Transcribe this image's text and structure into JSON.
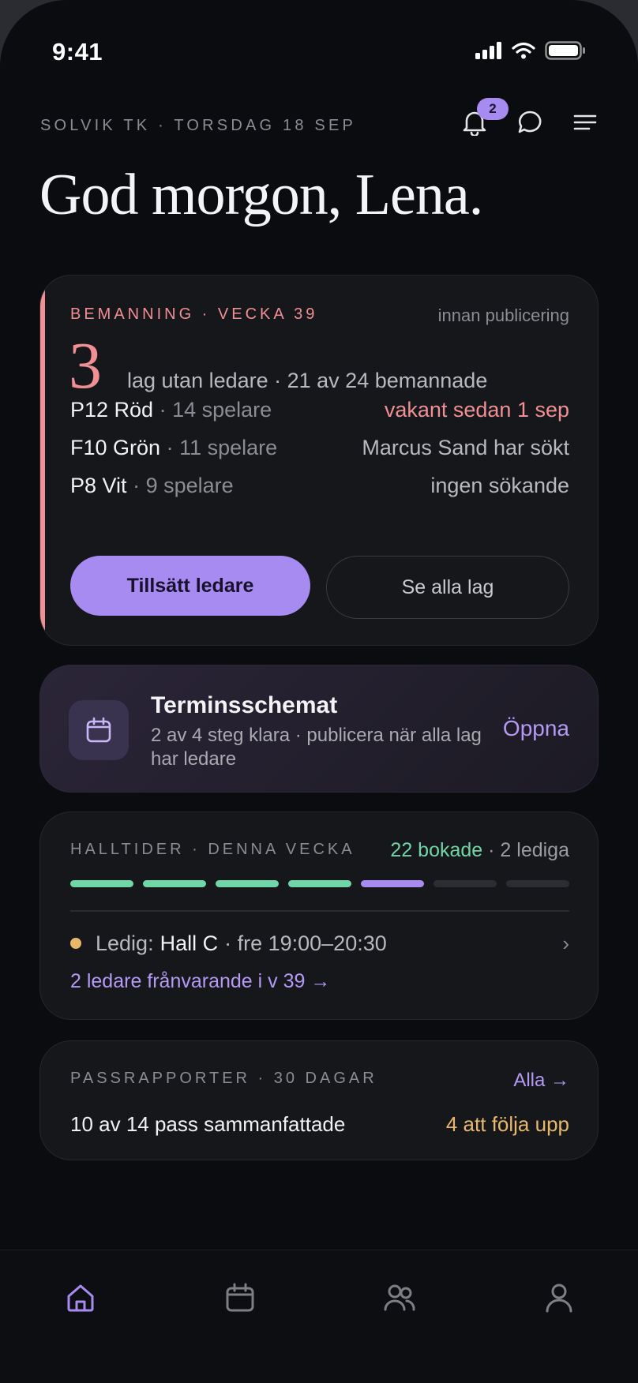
{
  "status_bar": {
    "time": "9:41"
  },
  "header": {
    "eyebrow": "SOLVIK TK · TORSDAG 18 SEP",
    "notifications_badge": "2",
    "greeting": "God morgon, Lena."
  },
  "staffing": {
    "kicker": "BEMANNING · VECKA 39",
    "note": "innan publicering",
    "count": "3",
    "count_text": "lag utan ledare · 21 av 24 bemannade",
    "teams": [
      {
        "name": "P12 Röd",
        "sep": " · ",
        "players": "14 spelare",
        "status": "vakant sedan 1 sep",
        "status_kind": "vacant"
      },
      {
        "name": "F10 Grön",
        "sep": " · ",
        "players": "11 spelare",
        "status": "Marcus Sand har sökt",
        "status_kind": "applied"
      },
      {
        "name": "P8 Vit",
        "sep": " · ",
        "players": "9 spelare",
        "status": "ingen sökande",
        "status_kind": "none"
      }
    ],
    "primary_button": "Tillsätt ledare",
    "secondary_button": "Se alla lag"
  },
  "schedule": {
    "icon": "calendar-icon",
    "title": "Terminsschemat",
    "subtitle": "2 av 4 steg klara · publicera när alla lag har ledare",
    "action": "Öppna"
  },
  "hall_times": {
    "kicker": "HALLTIDER · DENNA VECKA",
    "booked": "22 bokade",
    "free": " · 2 lediga",
    "segments": [
      "booked",
      "booked",
      "booked",
      "booked",
      "pending",
      "empty",
      "empty"
    ],
    "free_label": "Ledig:",
    "free_hall": "Hall C",
    "free_time": "· fre 19:00–20:30",
    "chevron": "›",
    "absent_link": "2 ledare frånvarande i v 39 →"
  },
  "reports": {
    "kicker": "PASSRAPPORTER · 30 DAGAR",
    "all_link": "Alla →",
    "summary": "10 av 14 pass sammanfattade",
    "follow_up": "4 att följa upp"
  },
  "tabbar": {
    "tabs": [
      {
        "icon": "home-icon",
        "active": true
      },
      {
        "icon": "calendar-icon",
        "active": false
      },
      {
        "icon": "team-icon",
        "active": false
      },
      {
        "icon": "profile-icon",
        "active": false
      }
    ]
  },
  "colors": {
    "accent": "#a78bf0",
    "alert": "#f08f94",
    "success": "#6fd6a8",
    "warning": "#e8b86a",
    "background": "#0b0c0f"
  }
}
